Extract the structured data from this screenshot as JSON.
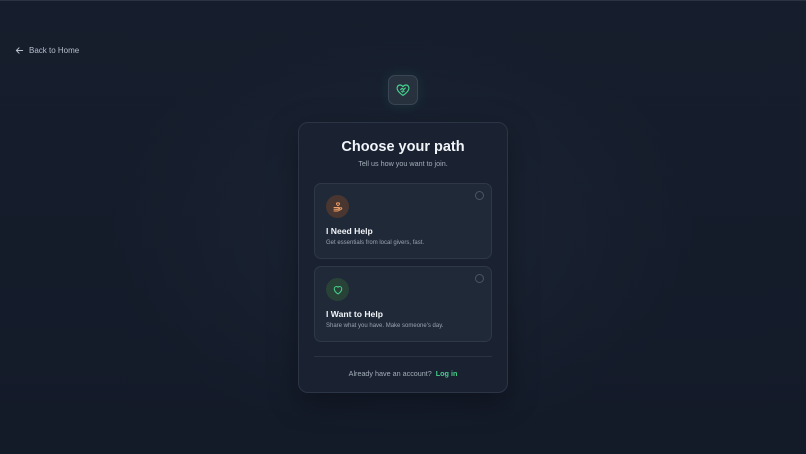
{
  "nav": {
    "back_label": "Back to Home"
  },
  "card": {
    "title": "Choose your path",
    "subtitle": "Tell us how you want to join.",
    "options": [
      {
        "title": "I Need Help",
        "description": "Get essentials from local givers, fast.",
        "icon": "hand-heart-icon"
      },
      {
        "title": "I Want to Help",
        "description": "Share what you have. Make someone's day.",
        "icon": "heart-icon"
      }
    ],
    "footer_text": "Already have an account?",
    "login_label": "Log in"
  },
  "colors": {
    "accent_green": "#45d08c",
    "accent_orange": "#f0a26a",
    "background": "#141c2b"
  }
}
